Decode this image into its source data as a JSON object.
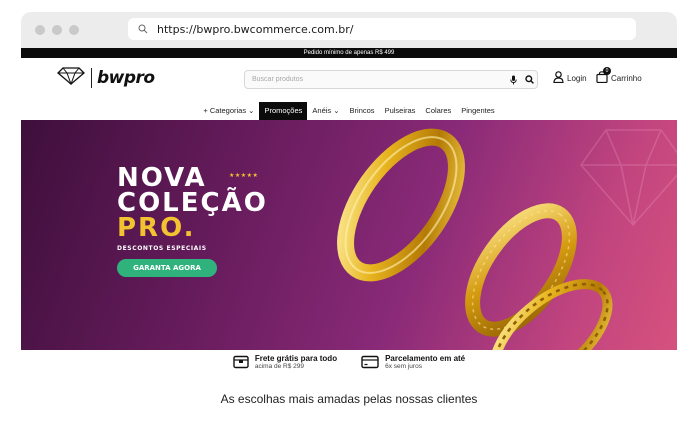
{
  "browser": {
    "url": "https://bwpro.bwcommerce.com.br/"
  },
  "announcement": "Pedido mínimo de apenas R$ 499",
  "header": {
    "brand": "bwpro",
    "search_placeholder": "Buscar produtos",
    "login_label": "Login",
    "cart_label": "Carrinho",
    "cart_count": "0"
  },
  "nav": {
    "items": [
      {
        "label": "+ Categorias ⌄"
      },
      {
        "label": "Promoções"
      },
      {
        "label": "Anéis ⌄"
      },
      {
        "label": "Brincos"
      },
      {
        "label": "Pulseiras"
      },
      {
        "label": "Colares"
      },
      {
        "label": "Pingentes"
      }
    ]
  },
  "hero": {
    "line1": "NOVA",
    "line2": "COLEÇÃO",
    "line3": "PRO",
    "line3_dot": ".",
    "stars": "★★★★★",
    "subtitle": "DESCONTOS ESPECIAIS",
    "cta": "GARANTA AGORA"
  },
  "features": [
    {
      "title": "Frete grátis para todo",
      "sub": "acima de R$ 299",
      "icon": "shipping-box-icon"
    },
    {
      "title": "Parcelamento em até",
      "sub": "6x sem juros",
      "icon": "credit-card-icon"
    }
  ],
  "section_title": "As escolhas mais amadas pelas nossas clientes",
  "colors": {
    "accent_gold": "#f2c230",
    "cta_green": "#2fb27c",
    "hero_purple": "#6a1d5f"
  }
}
